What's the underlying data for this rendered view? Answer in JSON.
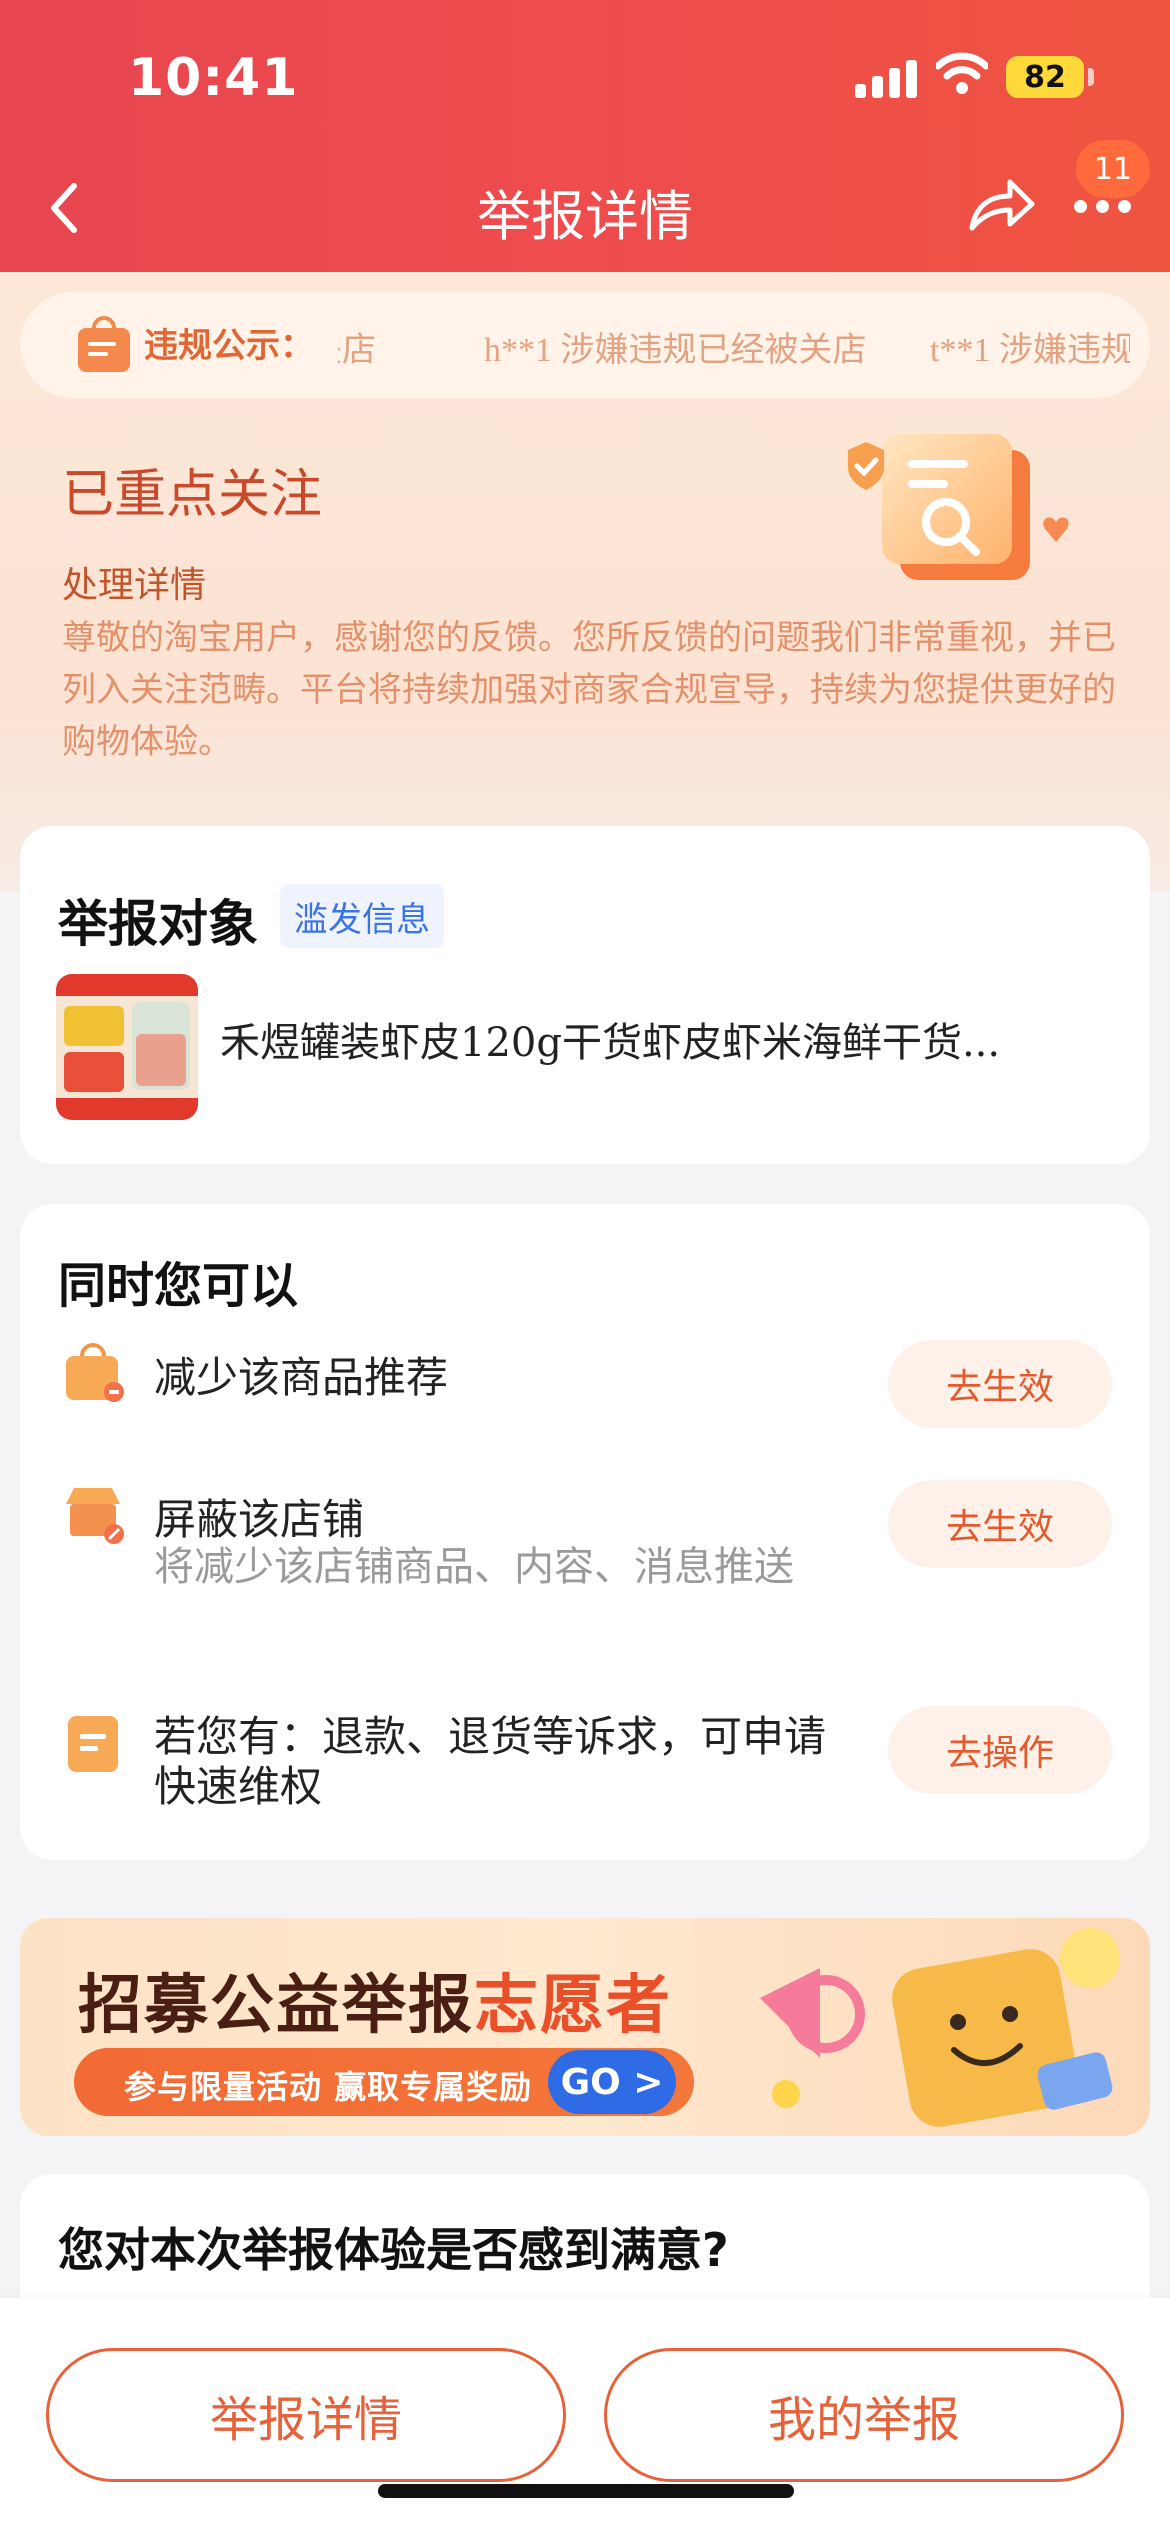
{
  "status_bar": {
    "time": "10:41",
    "battery": "82"
  },
  "header": {
    "title": "举报详情",
    "badge_count": "11"
  },
  "notice": {
    "label": "违规公示：",
    "items": [
      "攻关店",
      "h**1 涉嫌违规已经被关店",
      "t**1 涉嫌违规"
    ]
  },
  "status": {
    "title": "已重点关注",
    "detail_title": "处理详情",
    "detail_body": "尊敬的淘宝用户，感谢您的反馈。您所反馈的问题我们非常重视，并已列入关注范畴。平台将持续加强对商家合规宣导，持续为您提供更好的购物体验。"
  },
  "report": {
    "title": "举报对象",
    "tag": "滥发信息",
    "product_name": "禾煜罐装虾皮120g干货虾皮虾米海鲜干货..."
  },
  "actions": {
    "title": "同时您可以",
    "items": [
      {
        "title": "减少该商品推荐",
        "subtitle": "",
        "button": "去生效",
        "icon": "bag-minus-icon"
      },
      {
        "title": "屏蔽该店铺",
        "subtitle": "将减少该店铺商品、内容、消息推送",
        "button": "去生效",
        "icon": "shop-block-icon"
      },
      {
        "title": "若您有：退款、退货等诉求，可申请快速维权",
        "subtitle": "",
        "button": "去操作",
        "icon": "clipboard-icon"
      }
    ]
  },
  "banner": {
    "title_prefix": "招募公益举报",
    "title_highlight": "志愿者",
    "subtitle": "参与限量活动  赢取专属奖励",
    "go": "GO >"
  },
  "satisfaction": {
    "question": "您对本次举报体验是否感到满意?"
  },
  "bottom": {
    "left": "举报详情",
    "right": "我的举报"
  },
  "colors": {
    "header": "#ee4c4d",
    "accent": "#e5623a",
    "tag_blue": "#3c74e0"
  }
}
